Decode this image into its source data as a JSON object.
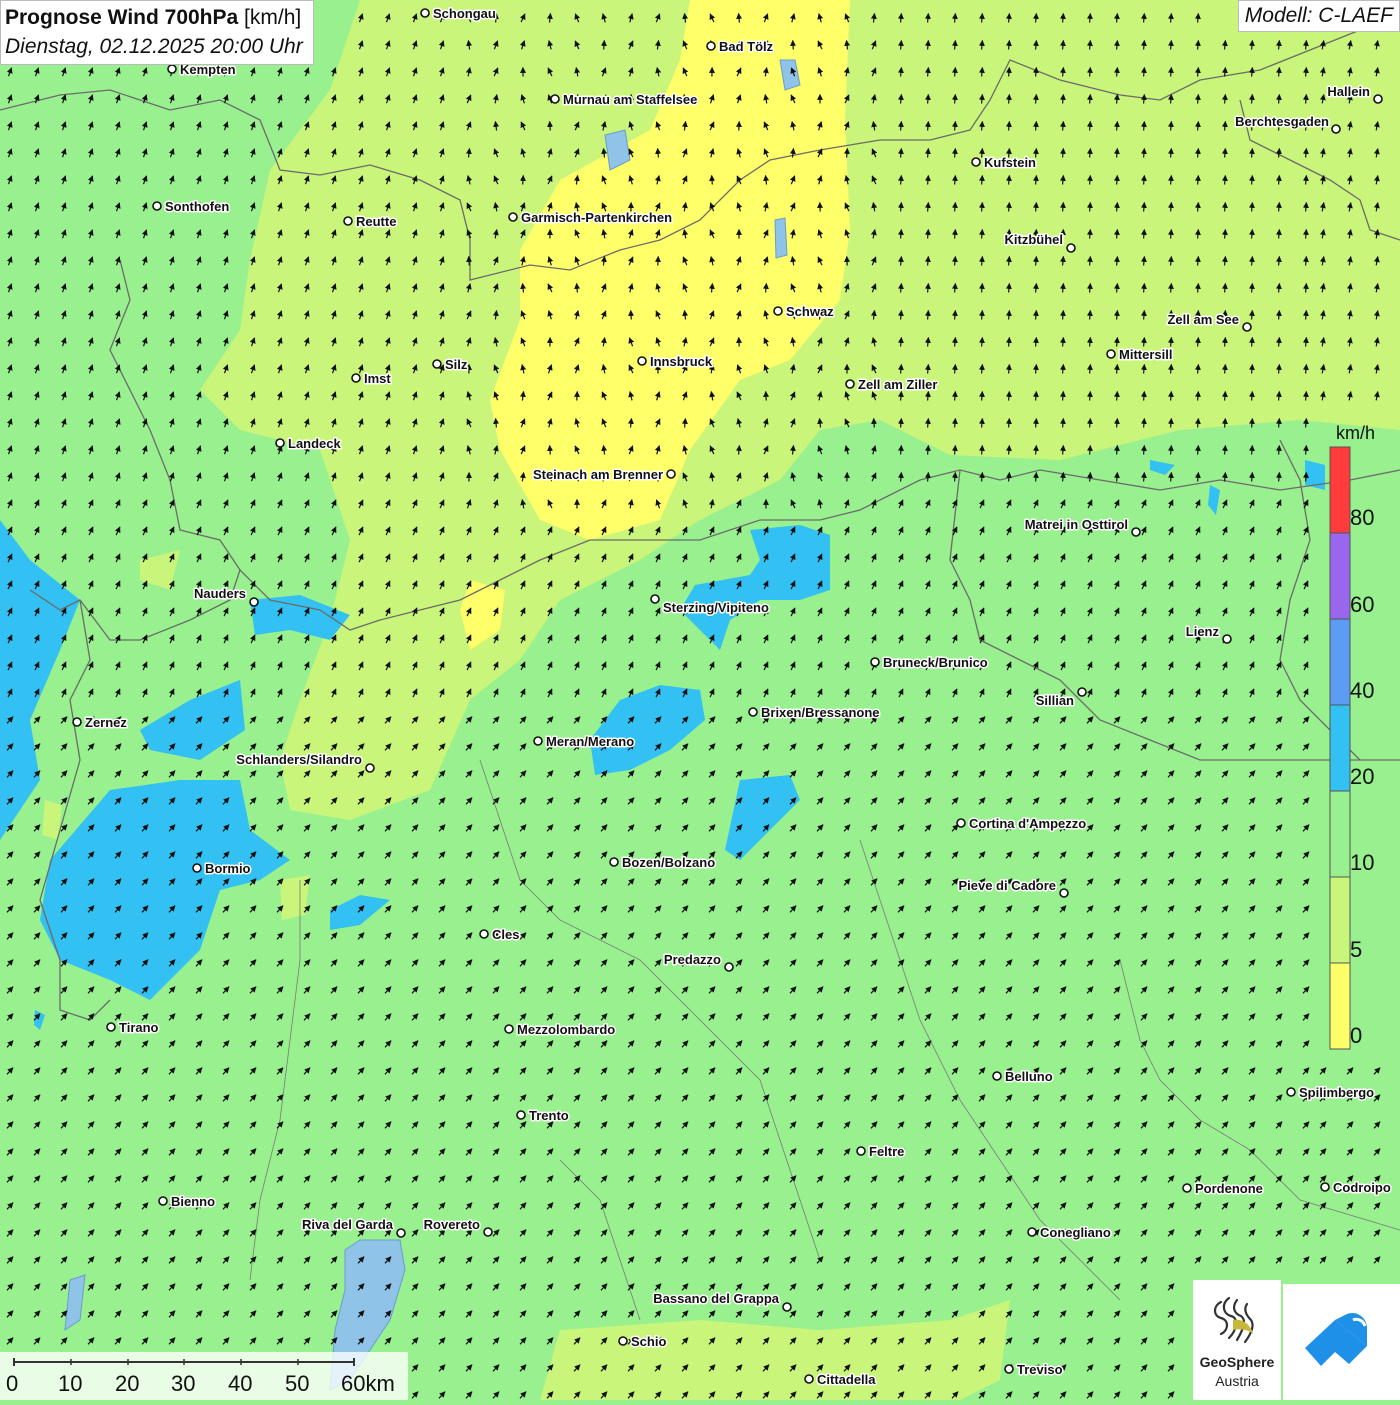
{
  "title": {
    "main": "Prognose Wind 700hPa",
    "unit": "[km/h]",
    "datetime": "Dienstag, 02.12.2025 20:00 Uhr"
  },
  "model": "Modell: C-LAEF",
  "legend": {
    "unit": "km/h",
    "labels": [
      "80",
      "60",
      "40",
      "20",
      "10",
      "5",
      "0"
    ],
    "colors": {
      "band_80_plus": "#ff3b3b",
      "band_60_80": "#9966ee",
      "band_40_60": "#5c9cf2",
      "band_20_40": "#33c0f2",
      "band_10_20": "#98f08f",
      "band_5_10": "#c8f57a",
      "band_0_5": "#ffff6a"
    }
  },
  "scalebar": {
    "labels": [
      "0",
      "10",
      "20",
      "30",
      "40",
      "50",
      "60km"
    ]
  },
  "towns": [
    "Schongau",
    "Bad Tölz",
    "Kempten",
    "Murnau am Staffelsee",
    "Hallein",
    "Berchtesgaden",
    "Kufstein",
    "Sonthofen",
    "Reutte",
    "Garmisch-Partenkirchen",
    "Kitzbühel",
    "Schwaz",
    "Zell am See",
    "Mittersill",
    "Innsbruck",
    "Silz",
    "Imst",
    "Zell am Ziller",
    "Landeck",
    "Steinach am Brenner",
    "Matrei in Osttirol",
    "Nauders",
    "Sterzing/Vipiteno",
    "Lienz",
    "Bruneck/Brunico",
    "Sillian",
    "Zernez",
    "Brixen/Bressanone",
    "Meran/Merano",
    "Schlanders/Silandro",
    "Cortina d'Ampezzo",
    "Bozen/Bolzano",
    "Bormio",
    "Pieve di Cadore",
    "Cles",
    "Predazzo",
    "Tirano",
    "Mezzolombardo",
    "Belluno",
    "Spilimbergo",
    "Trento",
    "Feltre",
    "Pordenone",
    "Codroipo",
    "Bienno",
    "Riva del Garda",
    "Rovereto",
    "Conegliano",
    "Bassano del Grappa",
    "Schio",
    "Treviso",
    "Cittadella"
  ],
  "logos": {
    "geosphere_name": "GeoSphere",
    "geosphere_sub": "Austria",
    "geosphere_icon": "geosphere-logo-icon",
    "app_icon": "weather-app-logo-icon"
  }
}
